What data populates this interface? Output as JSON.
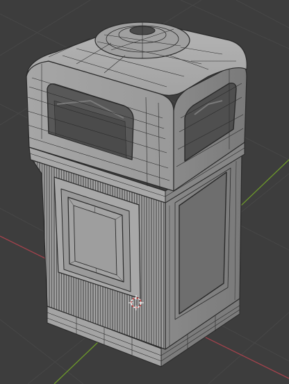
{
  "app": "Blender",
  "viewport": {
    "view": "perspective",
    "shading": "solid",
    "overlays": {
      "grid_floor": true,
      "x_axis_color": "#a3424c",
      "y_axis_color": "#6d9a2a",
      "wireframe_color": "#2a2a2a",
      "mesh_color": "#9c9c9c",
      "background_color": "#3d3d3d"
    },
    "object": "trash-bin-mesh",
    "cursor": "3d-cursor-icon"
  }
}
